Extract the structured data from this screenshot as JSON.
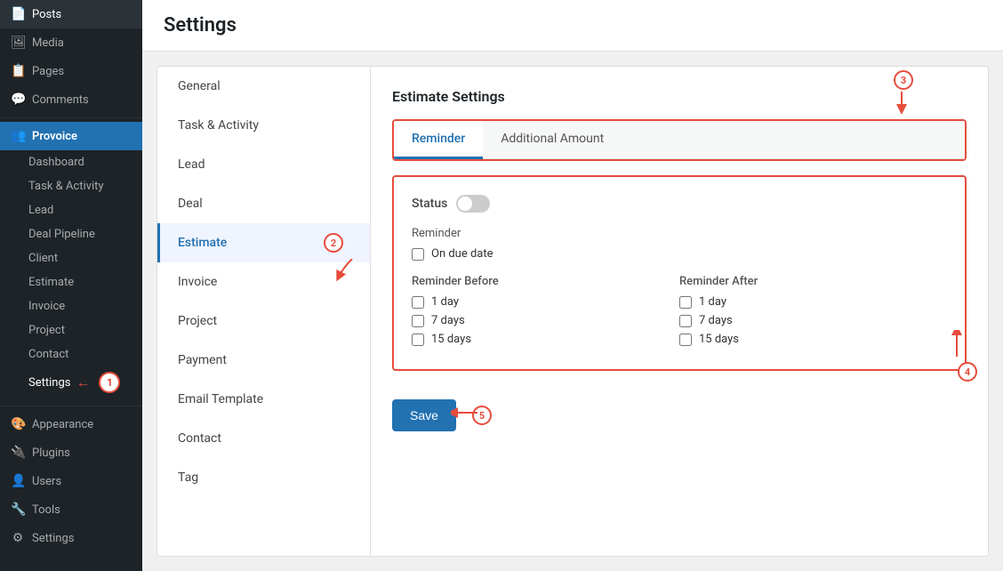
{
  "sidebar": {
    "wp_items": [
      {
        "label": "Posts",
        "icon": "📄",
        "name": "posts"
      },
      {
        "label": "Media",
        "icon": "🖼",
        "name": "media"
      },
      {
        "label": "Pages",
        "icon": "📋",
        "name": "pages"
      },
      {
        "label": "Comments",
        "icon": "💬",
        "name": "comments"
      }
    ],
    "provoice": {
      "label": "Provoice",
      "icon": "👥",
      "sub_items": [
        {
          "label": "Dashboard",
          "name": "dashboard"
        },
        {
          "label": "Task & Activity",
          "name": "task-activity"
        },
        {
          "label": "Lead",
          "name": "lead"
        },
        {
          "label": "Deal Pipeline",
          "name": "deal-pipeline"
        },
        {
          "label": "Client",
          "name": "client"
        },
        {
          "label": "Estimate",
          "name": "estimate"
        },
        {
          "label": "Invoice",
          "name": "invoice"
        },
        {
          "label": "Project",
          "name": "project"
        },
        {
          "label": "Contact",
          "name": "contact"
        },
        {
          "label": "Settings",
          "name": "settings"
        }
      ]
    },
    "wp_bottom_items": [
      {
        "label": "Appearance",
        "icon": "🎨",
        "name": "appearance"
      },
      {
        "label": "Plugins",
        "icon": "🔌",
        "name": "plugins"
      },
      {
        "label": "Users",
        "icon": "👤",
        "name": "users"
      },
      {
        "label": "Tools",
        "icon": "🔧",
        "name": "tools"
      },
      {
        "label": "Settings",
        "icon": "⚙",
        "name": "settings-wp"
      }
    ]
  },
  "page_title": "Settings",
  "settings_nav": [
    {
      "label": "General",
      "name": "general"
    },
    {
      "label": "Task & Activity",
      "name": "task-activity"
    },
    {
      "label": "Lead",
      "name": "lead"
    },
    {
      "label": "Deal",
      "name": "deal"
    },
    {
      "label": "Estimate",
      "name": "estimate",
      "active": true
    },
    {
      "label": "Invoice",
      "name": "invoice"
    },
    {
      "label": "Project",
      "name": "project"
    },
    {
      "label": "Payment",
      "name": "payment"
    },
    {
      "label": "Email Template",
      "name": "email-template"
    },
    {
      "label": "Contact",
      "name": "contact"
    },
    {
      "label": "Tag",
      "name": "tag"
    }
  ],
  "estimate_settings": {
    "title": "Estimate Settings",
    "tabs": [
      {
        "label": "Reminder",
        "active": true
      },
      {
        "label": "Additional Amount",
        "active": false
      }
    ],
    "status_label": "Status",
    "reminder_label": "Reminder",
    "on_due_date_label": "On due date",
    "reminder_before_label": "Reminder Before",
    "reminder_after_label": "Reminder After",
    "reminder_options": [
      {
        "label": "1 day"
      },
      {
        "label": "7 days"
      },
      {
        "label": "15 days"
      }
    ],
    "save_label": "Save"
  },
  "annotations": {
    "1": "1",
    "2": "2",
    "3": "3",
    "4": "4",
    "5": "5"
  }
}
